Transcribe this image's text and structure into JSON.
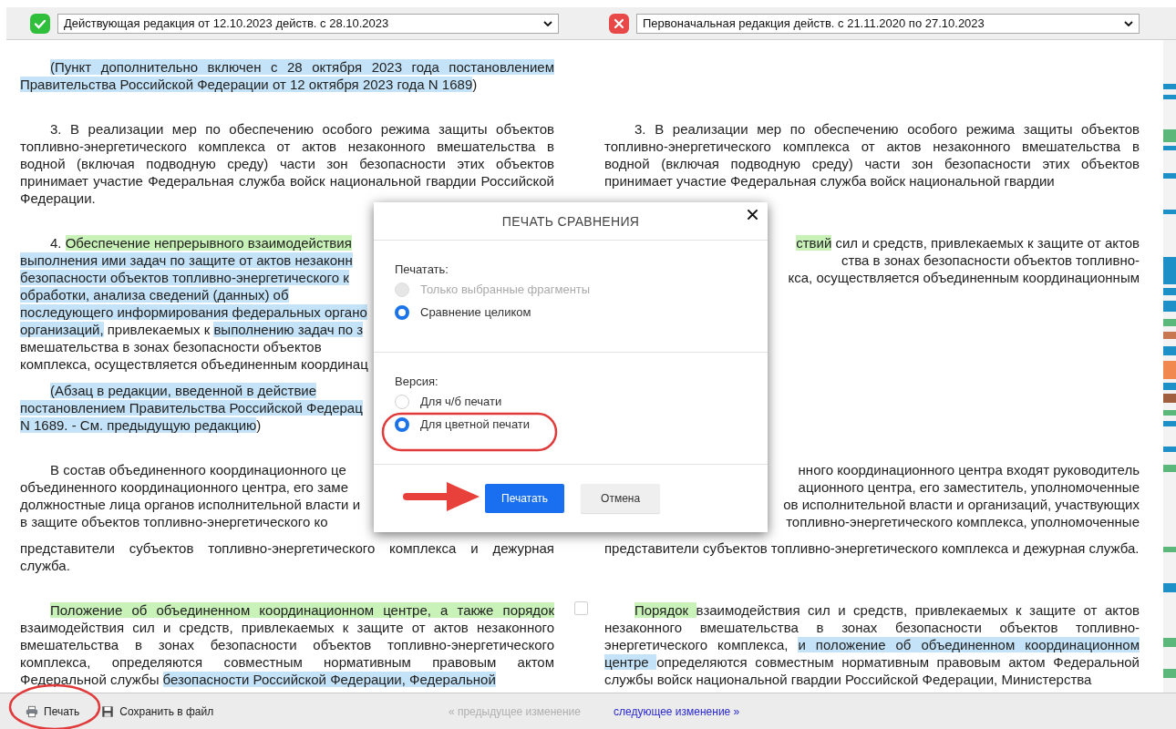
{
  "header": {
    "left": {
      "current": true,
      "version": "Действующая редакция от 12.10.2023 действ. с 28.10.2023"
    },
    "right": {
      "current": false,
      "version": "Первоначальная редакция действ. с 21.11.2020 по 27.10.2023"
    }
  },
  "rows": [
    {
      "left": [
        {
          "kind": "text",
          "indent": true,
          "segments": [
            {
              "text": "(Пункт дополнительно включен с 28 октября 2023 года постановлением Правительства Российской Федерации от 12 октября 2023 года N 1689",
              "color": "#c4e3f8"
            },
            {
              "text": ")"
            }
          ]
        }
      ],
      "right": []
    },
    {
      "left": [
        {
          "kind": "text",
          "indent": true,
          "segments": [
            {
              "text": "3. В реализации мер по обеспечению особого режима защиты объектов топливно-энергетического комплекса от актов незаконного вмешательства в водной (включая подводную среду) части зон безопасности этих объектов принимает участие Федеральная служба войск национальной гвардии Российской Федерации."
            }
          ]
        }
      ],
      "right": [
        {
          "kind": "text",
          "indent": true,
          "segments": [
            {
              "text": "3. В реализации мер по обеспечению особого режима защиты объектов топливно-энергетического комплекса от актов незаконного вмешательства в водной (включая подводную среду) части зон безопасности этих объектов принимает участие Федеральная служба войск национальной гвардии"
            }
          ]
        }
      ]
    },
    {
      "left": [
        {
          "kind": "fragment",
          "indent": true,
          "lines": [
            [
              {
                "text": "4. "
              },
              {
                "text": "Обеспечение непрерывного взаимодействия",
                "color": "#c9f2b8"
              }
            ],
            [
              {
                "text": "выполнения ими задач по защите от актов незаконн",
                "color": "#c4e3f8"
              }
            ],
            [
              {
                "text": "безопасности объектов топливно-энергетического к",
                "color": "#c4e3f8"
              }
            ],
            [
              {
                "text": "обработки, анализа сведений (данных) об",
                "color": "#c4e3f8"
              }
            ],
            [
              {
                "text": "последующего информирования федеральных органо",
                "color": "#c4e3f8"
              }
            ],
            [
              {
                "text": "организаций,",
                "color": "#c4e3f8"
              },
              {
                "text": " привлекаемых к "
              },
              {
                "text": "выполнению задач по з",
                "color": "#c4e3f8"
              }
            ],
            [
              {
                "text": "вмешательства в зонах безопасности объектов"
              }
            ],
            [
              {
                "text": "комплекса, осуществляется объединенным координац"
              }
            ]
          ]
        },
        {
          "kind": "fragment",
          "indent": true,
          "lines": [
            [
              {
                "text": "(Абзац в редакции, введенной в действие",
                "color": "#c4e3f8"
              }
            ],
            [
              {
                "text": "постановлением Правительства Российской Федерац",
                "color": "#c4e3f8"
              }
            ],
            [
              {
                "text": "N 1689. - См. предыдущую редакцию",
                "color": "#c4e3f8"
              },
              {
                "text": ")"
              }
            ]
          ]
        }
      ],
      "right": [
        {
          "kind": "fragment",
          "indent": false,
          "lines": [
            [
              {
                "text": "ствий",
                "color": "#c9f2b8"
              },
              {
                "text": " сил и средств, привлекаемых к защите от актов"
              }
            ],
            [
              {
                "text": "ства в зонах безопасности объектов топливно-"
              }
            ],
            [
              {
                "text": "кса, осуществляется объединенным координационным"
              }
            ]
          ]
        }
      ]
    },
    {
      "left": [
        {
          "kind": "fragment",
          "indent": true,
          "lines": [
            [
              {
                "text": "В состав объединенного координационного це"
              }
            ],
            [
              {
                "text": "объединенного координационного центра, его заме"
              }
            ],
            [
              {
                "text": "должностные лица органов исполнительной власти и"
              }
            ],
            [
              {
                "text": "в защите объектов топливно-энергетического ко"
              }
            ]
          ]
        },
        {
          "kind": "text",
          "indent": false,
          "segments": [
            {
              "text": "представители субъектов топливно-энергетического комплекса и дежурная служба."
            }
          ]
        }
      ],
      "right": [
        {
          "kind": "fragment",
          "indent": false,
          "lines": [
            [
              {
                "text": "нного координационного центра входят руководитель"
              }
            ],
            [
              {
                "text": "ационного центра, его заместитель, уполномоченные"
              }
            ],
            [
              {
                "text": "ов исполнительной власти и организаций, участвующих"
              }
            ],
            [
              {
                "text": "топливно-энергетического комплекса, уполномоченные"
              }
            ]
          ]
        },
        {
          "kind": "text",
          "indent": false,
          "segments": [
            {
              "text": "представители субъектов топливно-энергетического комплекса и дежурная служба."
            }
          ]
        }
      ]
    },
    {
      "gutter_checkbox": {
        "checked": false
      },
      "left": [
        {
          "kind": "text",
          "indent": true,
          "segments": [
            {
              "text": "Положение об объединенном координационном центре, а также порядок",
              "color": "#c9f2b8"
            },
            {
              "text": " взаимодействия сил и средств, привлекаемых к защите от актов незаконного вмешательства в зонах безопасности объектов топливно-энергетического комплекса, определяются совместным нормативным правовым актом Федеральной службы "
            },
            {
              "text": "безопасности Российской Федерации, Федеральной",
              "color": "#c4e3f8"
            }
          ]
        }
      ],
      "right": [
        {
          "kind": "text",
          "indent": true,
          "segments": [
            {
              "text": "Порядок ",
              "color": "#c9f2b8"
            },
            {
              "text": "взаимодействия сил и средств, привлекаемых к защите от актов незаконного вмешательства в зонах безопасности объектов топливно-энергетического комплекса, "
            },
            {
              "text": "и положение об объединенном координационном центре ",
              "color": "#c4e3f8"
            },
            {
              "text": "определяются совместным нормативным правовым актом Федеральной службы войск национальной гвардии Российской Федерации, Министерства"
            }
          ]
        }
      ]
    }
  ],
  "dialog": {
    "title": "ПЕЧАТЬ СРАВНЕНИЯ",
    "groups": [
      {
        "label": "Печатать:",
        "options": [
          {
            "label": "Только выбранные фрагменты",
            "selected": false,
            "disabled": true
          },
          {
            "label": "Сравнение целиком",
            "selected": true,
            "disabled": false
          }
        ]
      },
      {
        "label": "Версия:",
        "options": [
          {
            "label": "Для ч/б печати",
            "selected": false,
            "disabled": false
          },
          {
            "label": "Для цветной печати",
            "selected": true,
            "disabled": false
          }
        ]
      }
    ],
    "buttons": [
      {
        "label": "Печатать",
        "kind": "primary"
      },
      {
        "label": "Отмена",
        "kind": "secondary"
      }
    ]
  },
  "footer": {
    "print": "Печать",
    "save": "Сохранить в файл",
    "prev": {
      "label": "« предыдущее изменение",
      "disabled": true
    },
    "next": {
      "label": "следующее изменение »",
      "disabled": false
    }
  }
}
